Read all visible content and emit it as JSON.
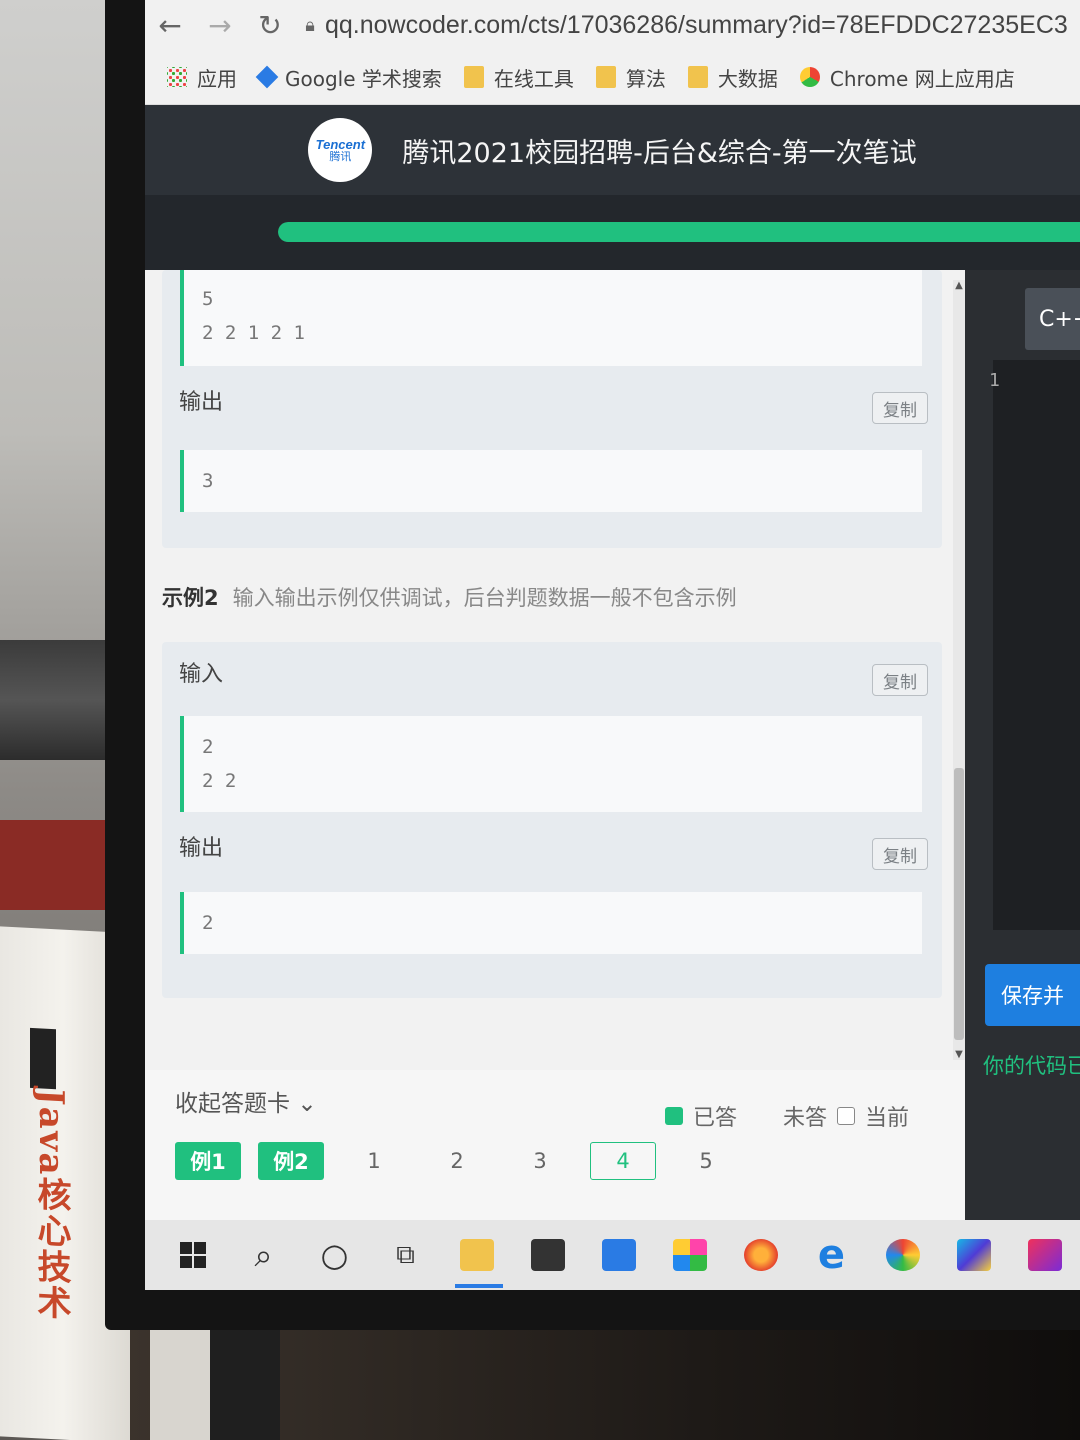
{
  "browser": {
    "url": "qq.nowcoder.com/cts/17036286/summary?id=78EFDDC27235EC3",
    "bookmarks": [
      "应用",
      "Google 学术搜索",
      "在线工具",
      "算法",
      "大数据",
      "Chrome 网上应用店"
    ]
  },
  "header": {
    "logo_en": "Tencent",
    "logo_cn": "腾讯",
    "title": "腾讯2021校园招聘-后台&综合-第一次笔试"
  },
  "progress": {
    "fraction": 1.0
  },
  "example1": {
    "input_text": "5\n2 2 1 2 1",
    "output_label": "输出",
    "output_text": "3",
    "copy_label": "复制"
  },
  "example2": {
    "title": "示例2",
    "note": "输入输出示例仅供调试，后台判题数据一般不包含示例",
    "input_label": "输入",
    "input_text": "2\n2 2",
    "output_label": "输出",
    "output_text": "2",
    "copy_label": "复制"
  },
  "answer_card": {
    "collapse_label": "收起答题卡",
    "legend": {
      "answered": "已答",
      "unanswered": "未答",
      "current": "当前"
    },
    "questions": [
      "例1",
      "例2",
      "1",
      "2",
      "3",
      "4",
      "5"
    ],
    "current_question": "4"
  },
  "editor": {
    "language": "C++",
    "line_number": "1",
    "save_label": "保存并",
    "status_text": "你的代码已"
  },
  "book": {
    "spine": "Java核心技术"
  },
  "colors": {
    "accent": "#20c07f",
    "header_bg": "#2d3238",
    "primary_button": "#1e7fe0"
  }
}
